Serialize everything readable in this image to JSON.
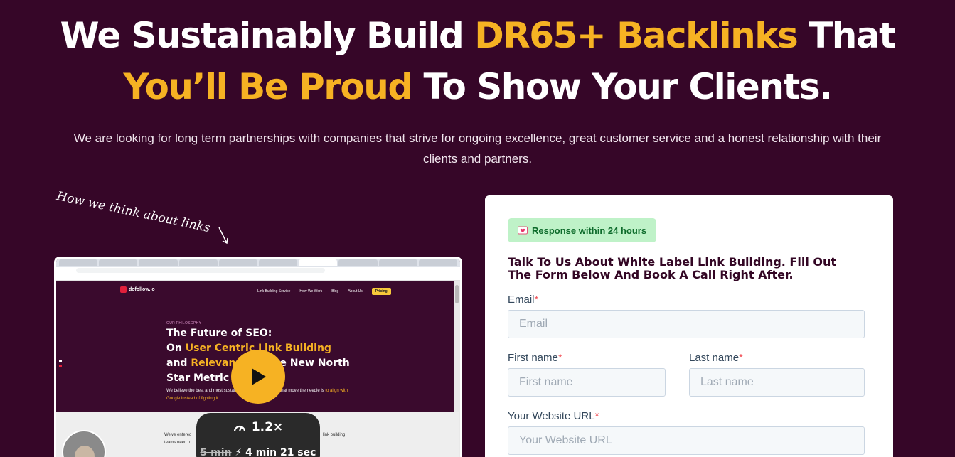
{
  "hero": {
    "title_part1": "We Sustainably Build ",
    "title_highlight1": "DR65+ Backlinks",
    "title_part2": " That",
    "title_highlight2": "You’ll Be Proud",
    "title_part3": " To Show Your Clients.",
    "subtitle": "We are looking for long term partnerships with companies that strive for ongoing excellence, great customer service and a honest relationship with their clients and partners."
  },
  "handnote": "How we think about links",
  "video": {
    "site_logo": "dofollow.io",
    "nav": [
      "Link Building Service",
      "How We Work",
      "Blog",
      "About Us"
    ],
    "nav_pricing": "Pricing",
    "eyebrow": "OUR PHILOSOPHY",
    "heading_line1": "The Future of SEO:",
    "heading_line2a": "On ",
    "heading_line2b": "User Centric Link Building",
    "heading_line3a": "and ",
    "heading_line3b": "Relevance",
    "heading_line3c": " as the New North",
    "heading_line4": "Star Metric",
    "desc_a": "We believe the best and most sustainable way to build links that move the needle is",
    "desc_b": "to align with Google instead of fighting it.",
    "lower_text1": "We've entered",
    "lower_text2": "link building",
    "lower_text3": "teams need to",
    "speed": "1.2×",
    "time_old": "5 min",
    "time_new": "4 min 21 sec"
  },
  "form": {
    "badge_icon": "heart-letter-icon",
    "badge": "Response within 24 hours",
    "title": "Talk To Us About White Label Link Building. Fill Out The Form Below And Book A Call Right After.",
    "email_label": "Email",
    "email_placeholder": "Email",
    "first_name_label": "First name",
    "first_name_placeholder": "First name",
    "last_name_label": "Last name",
    "last_name_placeholder": "Last name",
    "website_label": "Your Website URL",
    "website_placeholder": "Your Website URL",
    "required_mark": "*"
  },
  "colors": {
    "background": "#360628",
    "accent": "#f6b223",
    "badge_bg": "#bff2c8",
    "required": "#f2545b"
  }
}
